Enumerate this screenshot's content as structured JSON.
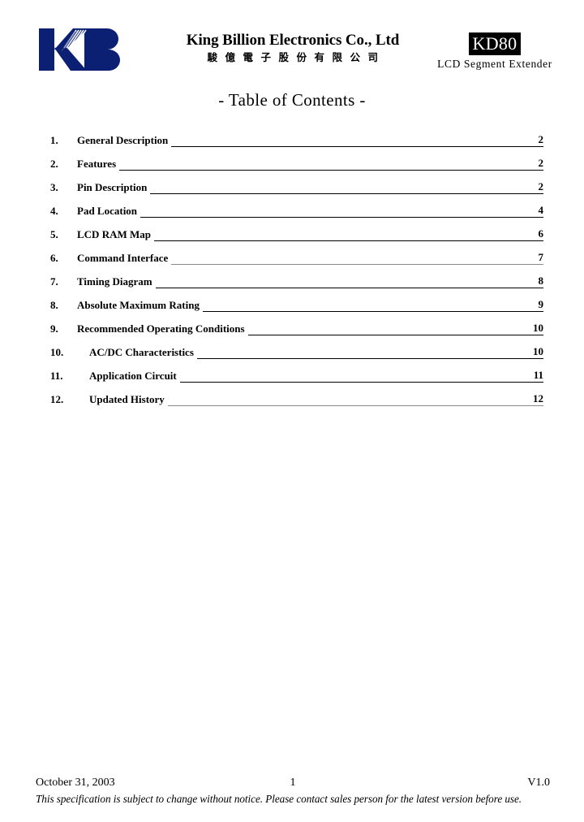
{
  "document": {
    "title": "-  Table of Contents -"
  },
  "header": {
    "logo": {
      "name": "king-billion-kb-logo",
      "text": "KB",
      "color": "#0b1f73"
    },
    "company_en": "King Billion Electronics Co., Ltd",
    "company_cn": "駿億電子股份有限公司",
    "part_number": "KD80",
    "part_description": "LCD Segment Extender",
    "badge_bg": "#000000",
    "badge_fg": "#ffffff"
  },
  "toc": {
    "entries": [
      {
        "num": "1.",
        "label": "General Description",
        "page": "2",
        "wide": false,
        "faint": false
      },
      {
        "num": "2.",
        "label": "Features",
        "page": "2",
        "wide": false,
        "faint": false
      },
      {
        "num": "3.",
        "label": "Pin Description",
        "page": "2",
        "wide": false,
        "faint": false
      },
      {
        "num": "4.",
        "label": "Pad Location",
        "page": "4",
        "wide": false,
        "faint": false
      },
      {
        "num": "5.",
        "label": "LCD RAM Map",
        "page": "6",
        "wide": false,
        "faint": false
      },
      {
        "num": "6.",
        "label": "Command Interface",
        "page": "7",
        "wide": false,
        "faint": true
      },
      {
        "num": "7.",
        "label": "Timing Diagram",
        "page": "8",
        "wide": false,
        "faint": false
      },
      {
        "num": "8.",
        "label": "Absolute Maximum Rating",
        "page": "9",
        "wide": false,
        "faint": false
      },
      {
        "num": "9.",
        "label": "Recommended Operating Conditions",
        "page": "10",
        "wide": false,
        "faint": false
      },
      {
        "num": "10.",
        "label": "AC/DC Characteristics",
        "page": "10",
        "wide": true,
        "faint": false
      },
      {
        "num": "11.",
        "label": "Application Circuit",
        "page": "11",
        "wide": true,
        "faint": false
      },
      {
        "num": "12.",
        "label": "Updated History",
        "page": "12",
        "wide": true,
        "faint": true
      }
    ]
  },
  "footer": {
    "date": "October 31, 2003",
    "page_number": "1",
    "version": "V1.0",
    "disclaimer": "This specification is subject to change without notice. Please contact sales person for the latest version before use."
  }
}
